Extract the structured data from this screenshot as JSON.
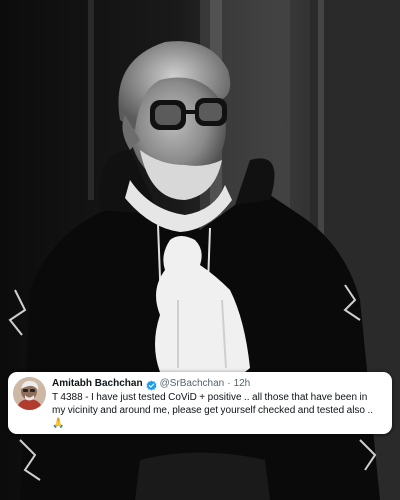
{
  "tweet": {
    "display_name": "Amitabh Bachchan",
    "handle": "@SrBachchan",
    "separator": "·",
    "timestamp": "12h",
    "text_lines": [
      "T 4388 - I have just tested CoViD + positive  .. all those that have been in",
      "my vicinity and around me, please get yourself checked and tested also .."
    ],
    "emoji": "🙏"
  },
  "colors": {
    "verified_badge": "#1d9bf0",
    "name_text": "#0f1419",
    "meta_text": "#536471"
  },
  "icons": {
    "verified": "verified-badge-icon",
    "emoji": "folded-hands-icon"
  }
}
